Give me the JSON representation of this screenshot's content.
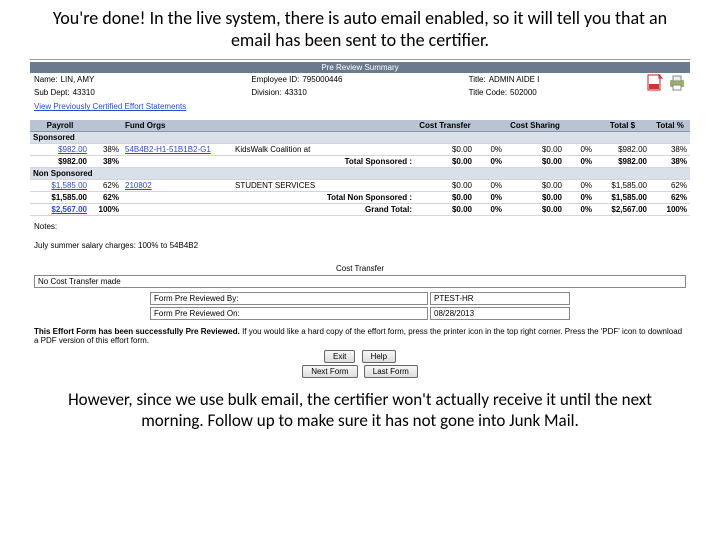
{
  "slide": {
    "top": "You're done!  In the live system, there is auto email enabled, so it will tell you that an email has been sent to the certifier.",
    "bottom": "However, since we use bulk email, the certifier won't actually receive it until the next morning.  Follow up to make sure it has not gone into Junk Mail."
  },
  "summary_title": "Pre Review Summary",
  "info": {
    "name_lbl": "Name:",
    "name_val": "LIN, AMY",
    "emp_lbl": "Employee ID:",
    "emp_val": "795000446",
    "title_lbl": "Title:",
    "title_val": "ADMIN AIDE I",
    "sub_lbl": "Sub Dept:",
    "sub_val": "43310",
    "div_lbl": "Division:",
    "div_val": "43310",
    "code_lbl": "Title Code:",
    "code_val": "502000"
  },
  "link_prev": "View Previously Certified Effort Statements",
  "headers": {
    "payroll": "Payroll",
    "fund": "Fund Orgs",
    "blank1": "",
    "ct": "Cost Transfer",
    "cs": "Cost Sharing",
    "total_s": "Total $",
    "total_p": "Total %"
  },
  "rows": {
    "section_sponsored": "Sponsored",
    "r1": {
      "payroll": "$982.00",
      "pct": "38%",
      "fund": "54B4B2-H1-51B1B2-G1",
      "desc": "KidsWalk Coalition at",
      "ct": "$0.00",
      "ctp": "0%",
      "cs": "$0.00",
      "csp": "0%",
      "tot": "$982.00",
      "totp": "38%"
    },
    "sub_sponsored": {
      "payroll": "$982.00",
      "pct": "38%",
      "label": "Total Sponsored  :",
      "ct": "$0.00",
      "ctp": "0%",
      "cs": "$0.00",
      "csp": "0%",
      "tot": "$982.00",
      "totp": "38%"
    },
    "section_non": "Non Sponsored",
    "r2": {
      "payroll": "$1,585.00",
      "pct": "62%",
      "fund": "210802",
      "desc": "STUDENT SERVICES",
      "ct": "$0.00",
      "ctp": "0%",
      "cs": "$0.00",
      "csp": "0%",
      "tot": "$1,585.00",
      "totp": "62%"
    },
    "sub_non": {
      "payroll": "$1,585.00",
      "pct": "62%",
      "label": "Total Non Sponsored :",
      "ct": "$0.00",
      "ctp": "0%",
      "cs": "$0.00",
      "csp": "0%",
      "tot": "$1,585.00",
      "totp": "62%"
    },
    "grand": {
      "payroll": "$2,567.00",
      "pct": "100%",
      "label": "Grand Total:",
      "ct": "$0.00",
      "ctp": "0%",
      "cs": "$0.00",
      "csp": "0%",
      "tot": "$2,567.00",
      "totp": "100%"
    }
  },
  "notes_lbl": "Notes:",
  "notes_body": "July summer salary charges: 100% to 54B4B2",
  "ct_header": "Cost Transfer",
  "ct_none": "No Cost Transfer made",
  "form": {
    "by_lbl": "Form Pre Reviewed By:",
    "by_val": "PTEST-HR",
    "on_lbl": "Form Pre Reviewed On:",
    "on_val": "08/28/2013"
  },
  "msg_bold": "This Effort Form has been successfully Pre Reviewed.",
  "msg_rest": " If you would like a hard copy of the effort form, press the printer icon in the top right corner. Press the 'PDF' icon to download a PDF version of this effort form.",
  "buttons": {
    "exit": "Exit",
    "help": "Help",
    "next": "Next Form",
    "last": "Last Form"
  }
}
